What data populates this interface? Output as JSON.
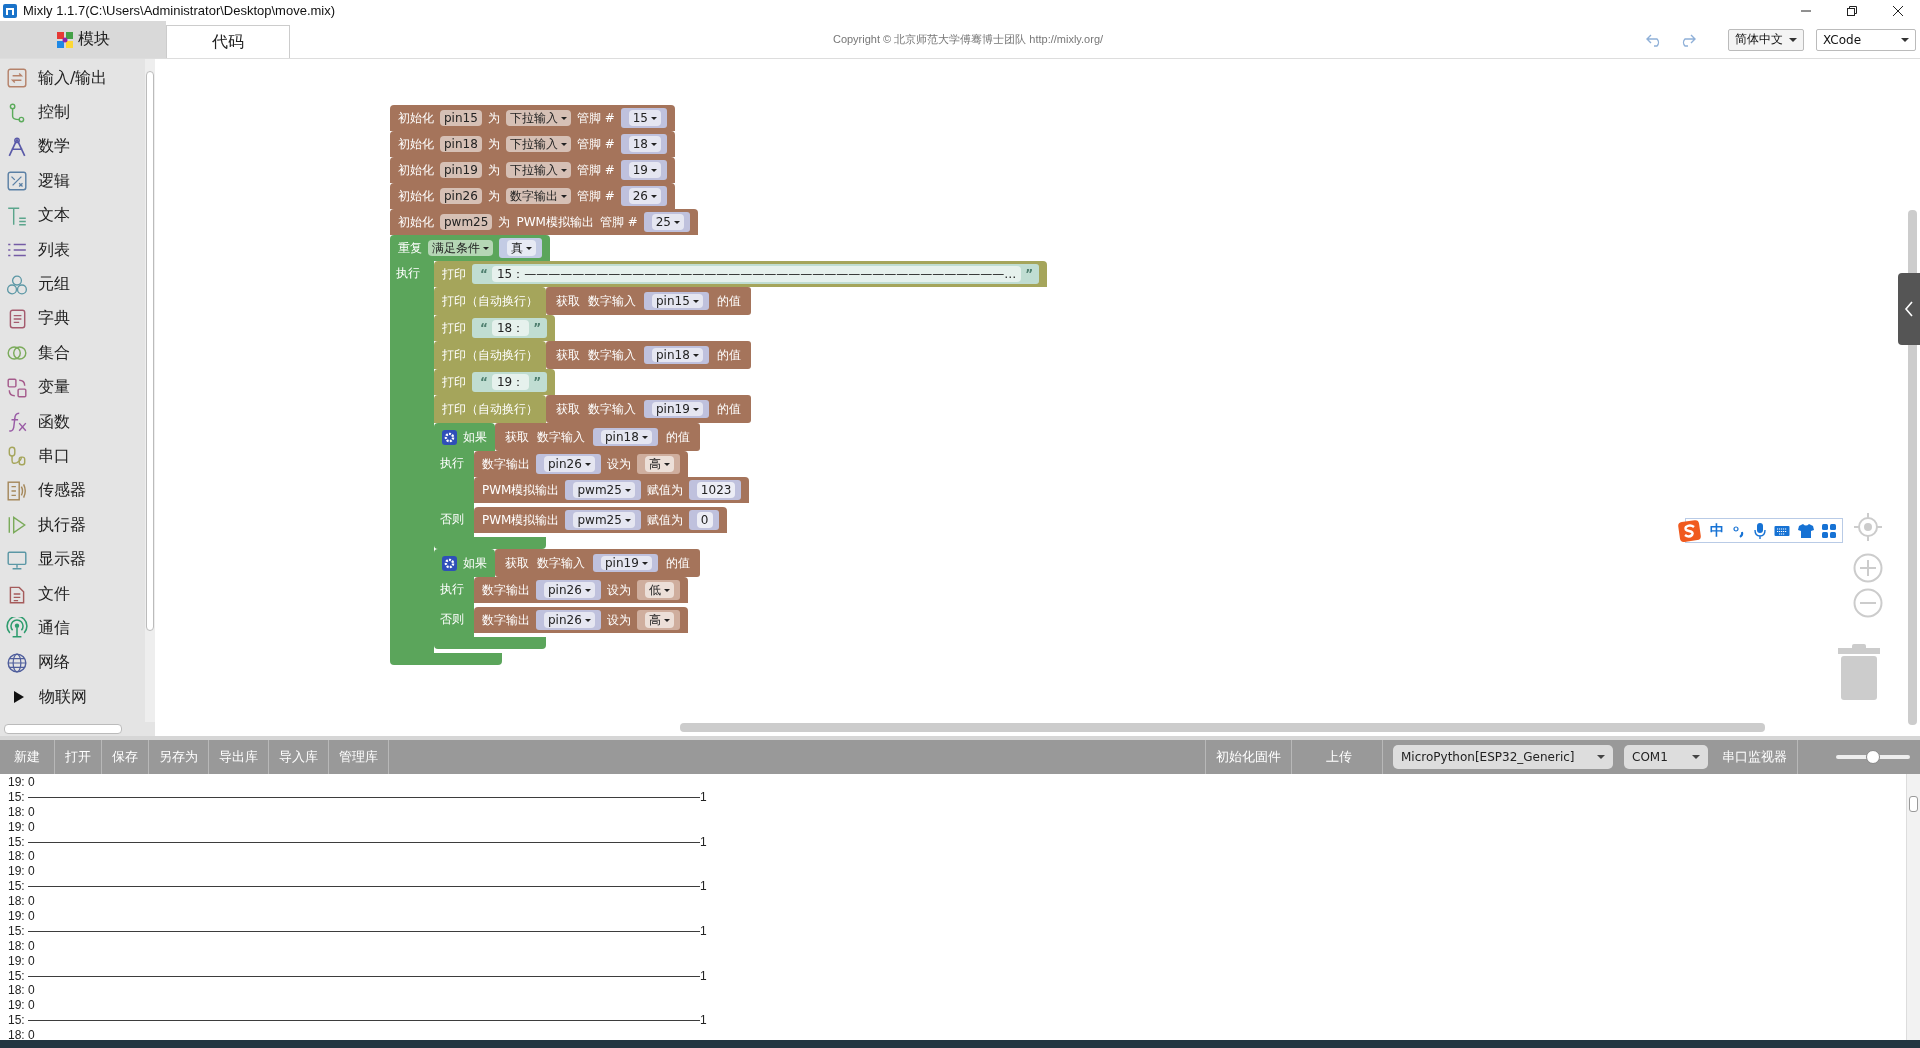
{
  "window": {
    "title": "Mixly 1.1.7(C:\\Users\\Administrator\\Desktop\\move.mix)"
  },
  "tabs": [
    {
      "label": "模块",
      "selected": true
    },
    {
      "label": "代码",
      "selected": false
    }
  ],
  "copyright": "Copyright © 北京师范大学傅骞博士团队 http://mixly.org/",
  "language": "简体中文",
  "theme": "XCode",
  "sidebar": {
    "items": [
      {
        "label": "输入/输出",
        "kind": "category"
      },
      {
        "label": "控制",
        "kind": "category"
      },
      {
        "label": "数学",
        "kind": "category"
      },
      {
        "label": "逻辑",
        "kind": "category"
      },
      {
        "label": "文本",
        "kind": "category"
      },
      {
        "label": "列表",
        "kind": "category"
      },
      {
        "label": "元组",
        "kind": "category"
      },
      {
        "label": "字典",
        "kind": "category"
      },
      {
        "label": "集合",
        "kind": "category"
      },
      {
        "label": "变量",
        "kind": "category"
      },
      {
        "label": "函数",
        "kind": "category"
      },
      {
        "label": "串口",
        "kind": "category"
      },
      {
        "label": "传感器",
        "kind": "category"
      },
      {
        "label": "执行器",
        "kind": "category"
      },
      {
        "label": "显示器",
        "kind": "category"
      },
      {
        "label": "文件",
        "kind": "category"
      },
      {
        "label": "通信",
        "kind": "category"
      },
      {
        "label": "网络",
        "kind": "category"
      },
      {
        "label": "物联网",
        "kind": "folder"
      }
    ]
  },
  "workspace": {
    "blocks": [
      {
        "color": "#a5745b",
        "parts": [
          {
            "kind": "text",
            "text": "初始化"
          },
          {
            "kind": "name",
            "text": "pin15"
          },
          {
            "kind": "text",
            "text": "为"
          },
          {
            "kind": "select",
            "text": "下拉输入"
          },
          {
            "kind": "text",
            "text": "管脚 #"
          },
          {
            "kind": "socket",
            "color": "#bfc1dd",
            "parts": [
              {
                "kind": "select",
                "text": "15"
              }
            ]
          }
        ]
      },
      {
        "color": "#a5745b",
        "parts": [
          {
            "kind": "text",
            "text": "初始化"
          },
          {
            "kind": "name",
            "text": "pin18"
          },
          {
            "kind": "text",
            "text": "为"
          },
          {
            "kind": "select",
            "text": "下拉输入"
          },
          {
            "kind": "text",
            "text": "管脚 #"
          },
          {
            "kind": "socket",
            "color": "#bfc1dd",
            "parts": [
              {
                "kind": "select",
                "text": "18"
              }
            ]
          }
        ]
      },
      {
        "color": "#a5745b",
        "parts": [
          {
            "kind": "text",
            "text": "初始化"
          },
          {
            "kind": "name",
            "text": "pin19"
          },
          {
            "kind": "text",
            "text": "为"
          },
          {
            "kind": "select",
            "text": "下拉输入"
          },
          {
            "kind": "text",
            "text": "管脚 #"
          },
          {
            "kind": "socket",
            "color": "#bfc1dd",
            "parts": [
              {
                "kind": "select",
                "text": "19"
              }
            ]
          }
        ]
      },
      {
        "color": "#a5745b",
        "parts": [
          {
            "kind": "text",
            "text": "初始化"
          },
          {
            "kind": "name",
            "text": "pin26"
          },
          {
            "kind": "text",
            "text": "为"
          },
          {
            "kind": "select",
            "text": "数字输出"
          },
          {
            "kind": "text",
            "text": "管脚 #"
          },
          {
            "kind": "socket",
            "color": "#bfc1dd",
            "parts": [
              {
                "kind": "select",
                "text": "26"
              }
            ]
          }
        ]
      },
      {
        "color": "#a5745b",
        "parts": [
          {
            "kind": "text",
            "text": "初始化"
          },
          {
            "kind": "name",
            "text": "pwm25"
          },
          {
            "kind": "text",
            "text": "为"
          },
          {
            "kind": "text",
            "text": "PWM模拟输出"
          },
          {
            "kind": "text",
            "text": "管脚 #"
          },
          {
            "kind": "socket",
            "color": "#bfc1dd",
            "parts": [
              {
                "kind": "select",
                "text": "25"
              }
            ]
          }
        ]
      },
      {
        "color": "#5ba55b",
        "parts": [
          {
            "kind": "text",
            "text": "重复"
          },
          {
            "kind": "select",
            "text": "满足条件"
          },
          {
            "kind": "socket",
            "color": "#c3cbe4",
            "parts": [
              {
                "kind": "select",
                "text": "真"
              }
            ]
          }
        ],
        "sections": [
          {
            "label": "执行",
            "children": [
              {
                "color": "#a5a55b",
                "parts": [
                  {
                    "kind": "text",
                    "text": "打印"
                  },
                  {
                    "kind": "socket",
                    "color": "#c0ddd2",
                    "parts": [
                      {
                        "kind": "quote",
                        "text": "“"
                      },
                      {
                        "kind": "string",
                        "text": "15：————————————————————————————————————————…"
                      },
                      {
                        "kind": "quote",
                        "text": "”"
                      }
                    ]
                  }
                ]
              },
              {
                "color": "#a5a55b",
                "parts": [
                  {
                    "kind": "text",
                    "text": "打印（自动换行）"
                  },
                  {
                    "kind": "block",
                    "color": "#a5745b",
                    "parts": [
                      {
                        "kind": "text",
                        "text": "获取"
                      },
                      {
                        "kind": "text",
                        "text": "数字输入"
                      },
                      {
                        "kind": "socket",
                        "color": "#bfc1dd",
                        "parts": [
                          {
                            "kind": "select",
                            "text": "pin15"
                          }
                        ]
                      },
                      {
                        "kind": "text",
                        "text": "的值"
                      }
                    ]
                  }
                ]
              },
              {
                "color": "#a5a55b",
                "parts": [
                  {
                    "kind": "text",
                    "text": "打印"
                  },
                  {
                    "kind": "socket",
                    "color": "#c0ddd2",
                    "parts": [
                      {
                        "kind": "quote",
                        "text": "“"
                      },
                      {
                        "kind": "string",
                        "text": "18："
                      },
                      {
                        "kind": "quote",
                        "text": "”"
                      }
                    ]
                  }
                ]
              },
              {
                "color": "#a5a55b",
                "parts": [
                  {
                    "kind": "text",
                    "text": "打印（自动换行）"
                  },
                  {
                    "kind": "block",
                    "color": "#a5745b",
                    "parts": [
                      {
                        "kind": "text",
                        "text": "获取"
                      },
                      {
                        "kind": "text",
                        "text": "数字输入"
                      },
                      {
                        "kind": "socket",
                        "color": "#bfc1dd",
                        "parts": [
                          {
                            "kind": "select",
                            "text": "pin18"
                          }
                        ]
                      },
                      {
                        "kind": "text",
                        "text": "的值"
                      }
                    ]
                  }
                ]
              },
              {
                "color": "#a5a55b",
                "parts": [
                  {
                    "kind": "text",
                    "text": "打印"
                  },
                  {
                    "kind": "socket",
                    "color": "#c0ddd2",
                    "parts": [
                      {
                        "kind": "quote",
                        "text": "“"
                      },
                      {
                        "kind": "string",
                        "text": "19："
                      },
                      {
                        "kind": "quote",
                        "text": "”"
                      }
                    ]
                  }
                ]
              },
              {
                "color": "#a5a55b",
                "parts": [
                  {
                    "kind": "text",
                    "text": "打印（自动换行）"
                  },
                  {
                    "kind": "block",
                    "color": "#a5745b",
                    "parts": [
                      {
                        "kind": "text",
                        "text": "获取"
                      },
                      {
                        "kind": "text",
                        "text": "数字输入"
                      },
                      {
                        "kind": "socket",
                        "color": "#bfc1dd",
                        "parts": [
                          {
                            "kind": "select",
                            "text": "pin19"
                          }
                        ]
                      },
                      {
                        "kind": "text",
                        "text": "的值"
                      }
                    ]
                  }
                ]
              },
              {
                "color": "#5ba55b",
                "parts": [
                  {
                    "kind": "gear"
                  },
                  {
                    "kind": "text",
                    "text": "如果"
                  },
                  {
                    "kind": "block",
                    "color": "#a5745b",
                    "parts": [
                      {
                        "kind": "text",
                        "text": "获取"
                      },
                      {
                        "kind": "text",
                        "text": "数字输入"
                      },
                      {
                        "kind": "socket",
                        "color": "#bfc1dd",
                        "parts": [
                          {
                            "kind": "select",
                            "text": "pin18"
                          }
                        ]
                      },
                      {
                        "kind": "text",
                        "text": "的值"
                      }
                    ]
                  }
                ],
                "sections": [
                  {
                    "label": "执行",
                    "children": [
                      {
                        "color": "#a5745b",
                        "parts": [
                          {
                            "kind": "text",
                            "text": "数字输出"
                          },
                          {
                            "kind": "socket",
                            "color": "#bfc1dd",
                            "parts": [
                              {
                                "kind": "select",
                                "text": "pin26"
                              }
                            ]
                          },
                          {
                            "kind": "text",
                            "text": "设为"
                          },
                          {
                            "kind": "socket",
                            "color": "#cfae9e",
                            "parts": [
                              {
                                "kind": "select",
                                "text": "高"
                              }
                            ]
                          }
                        ]
                      },
                      {
                        "color": "#a5745b",
                        "parts": [
                          {
                            "kind": "text",
                            "text": "PWM模拟输出"
                          },
                          {
                            "kind": "socket",
                            "color": "#bfc1dd",
                            "parts": [
                              {
                                "kind": "select",
                                "text": "pwm25"
                              }
                            ]
                          },
                          {
                            "kind": "text",
                            "text": "赋值为"
                          },
                          {
                            "kind": "socket",
                            "color": "#bfc1dd",
                            "parts": [
                              {
                                "kind": "number",
                                "text": "1023"
                              }
                            ]
                          }
                        ]
                      }
                    ]
                  },
                  {
                    "label": "否则",
                    "children": [
                      {
                        "color": "#a5745b",
                        "parts": [
                          {
                            "kind": "text",
                            "text": "PWM模拟输出"
                          },
                          {
                            "kind": "socket",
                            "color": "#bfc1dd",
                            "parts": [
                              {
                                "kind": "select",
                                "text": "pwm25"
                              }
                            ]
                          },
                          {
                            "kind": "text",
                            "text": "赋值为"
                          },
                          {
                            "kind": "socket",
                            "color": "#bfc1dd",
                            "parts": [
                              {
                                "kind": "number",
                                "text": "0"
                              }
                            ]
                          }
                        ]
                      }
                    ]
                  }
                ]
              },
              {
                "color": "#5ba55b",
                "parts": [
                  {
                    "kind": "gear"
                  },
                  {
                    "kind": "text",
                    "text": "如果"
                  },
                  {
                    "kind": "block",
                    "color": "#a5745b",
                    "parts": [
                      {
                        "kind": "text",
                        "text": "获取"
                      },
                      {
                        "kind": "text",
                        "text": "数字输入"
                      },
                      {
                        "kind": "socket",
                        "color": "#bfc1dd",
                        "parts": [
                          {
                            "kind": "select",
                            "text": "pin19"
                          }
                        ]
                      },
                      {
                        "kind": "text",
                        "text": "的值"
                      }
                    ]
                  }
                ],
                "sections": [
                  {
                    "label": "执行",
                    "children": [
                      {
                        "color": "#a5745b",
                        "parts": [
                          {
                            "kind": "text",
                            "text": "数字输出"
                          },
                          {
                            "kind": "socket",
                            "color": "#bfc1dd",
                            "parts": [
                              {
                                "kind": "select",
                                "text": "pin26"
                              }
                            ]
                          },
                          {
                            "kind": "text",
                            "text": "设为"
                          },
                          {
                            "kind": "socket",
                            "color": "#cfae9e",
                            "parts": [
                              {
                                "kind": "select",
                                "text": "低"
                              }
                            ]
                          }
                        ]
                      }
                    ]
                  },
                  {
                    "label": "否则",
                    "children": [
                      {
                        "color": "#a5745b",
                        "parts": [
                          {
                            "kind": "text",
                            "text": "数字输出"
                          },
                          {
                            "kind": "socket",
                            "color": "#bfc1dd",
                            "parts": [
                              {
                                "kind": "select",
                                "text": "pin26"
                              }
                            ]
                          },
                          {
                            "kind": "text",
                            "text": "设为"
                          },
                          {
                            "kind": "socket",
                            "color": "#cfae9e",
                            "parts": [
                              {
                                "kind": "select",
                                "text": "高"
                              }
                            ]
                          }
                        ]
                      }
                    ]
                  }
                ]
              }
            ]
          }
        ]
      }
    ]
  },
  "ime": {
    "label": "中"
  },
  "toolbar": {
    "buttons": [
      "新建",
      "打开",
      "保存",
      "另存为",
      "导出库",
      "导入库",
      "管理库"
    ],
    "firmware": "初始化固件",
    "upload": "上传",
    "board": "MicroPython[ESP32_Generic]",
    "port": "COM1",
    "monitor": "串口监视器",
    "zoom_slider": {
      "level": 0.5
    }
  },
  "console": {
    "lines": [
      "19: 0",
      "15: ————————————————————————————————————————————————————————1",
      "18: 0",
      "19: 0",
      "15: ————————————————————————————————————————————————————————1",
      "18: 0",
      "19: 0",
      "15: ————————————————————————————————————————————————————————1",
      "18: 0",
      "19: 0",
      "15: ————————————————————————————————————————————————————————1",
      "18: 0",
      "19: 0",
      "15: ————————————————————————————————————————————————————————1",
      "18: 0",
      "19: 0",
      "15: ————————————————————————————————————————————————————————1",
      "18: 0"
    ]
  }
}
